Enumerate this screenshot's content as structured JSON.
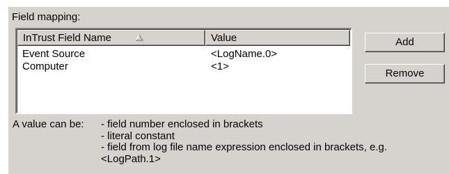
{
  "field_mapping": {
    "title": "Field mapping:",
    "columns": [
      {
        "label": "InTrust Field Name",
        "sort_icon": "sort-ascending-icon"
      },
      {
        "label": "Value"
      }
    ],
    "rows": [
      {
        "field": "Event Source",
        "value": "<LogName.0>"
      },
      {
        "field": "Computer",
        "value": "<1>"
      }
    ]
  },
  "buttons": {
    "add_label": "Add",
    "remove_label": "Remove"
  },
  "help": {
    "lead": "A value can be:",
    "lines": [
      "- field number enclosed in brackets",
      "- literal constant",
      "- field from log file name expression enclosed in brackets, e.g.",
      "<LogPath.1>"
    ]
  },
  "colors": {
    "face": "#d6d3ce",
    "window": "#ffffff",
    "shadow": "#808080",
    "dark_shadow": "#404040"
  }
}
